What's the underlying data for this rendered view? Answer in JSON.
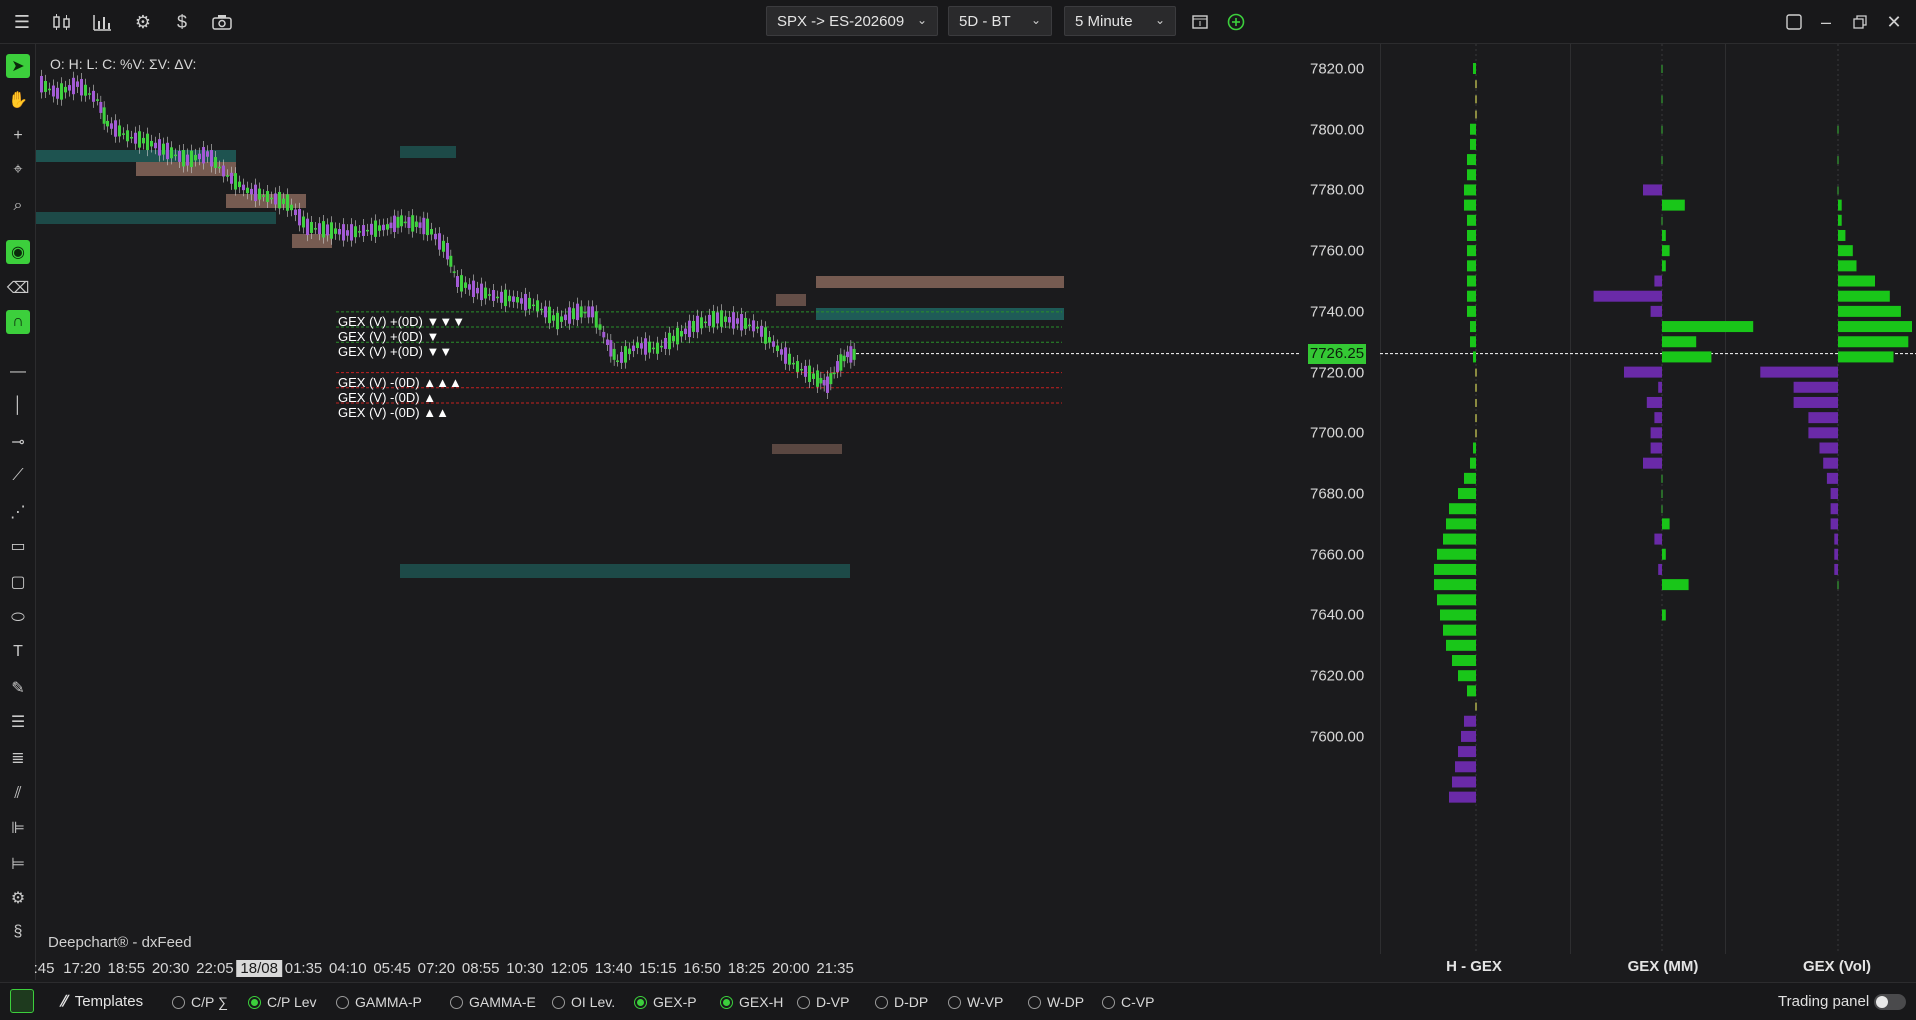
{
  "toolbar": {
    "symbol": "SPX -> ES-202609",
    "range": "5D - BT",
    "interval": "5 Minute"
  },
  "chart": {
    "ohlc_line": "O: H: L: C: %V: ΣV: ΔV:",
    "brand": "Deepchart® - dxFeed",
    "current_price": "7726.25",
    "gex_labels": [
      {
        "text": "GEX (V) +(0D)  ▼▼▼",
        "price": 7740,
        "color": "#2a8f2a"
      },
      {
        "text": "GEX (V) +(0D)  ▼",
        "price": 7735,
        "color": "#2a8f2a"
      },
      {
        "text": "GEX (V) +(0D)  ▼▼",
        "price": 7730,
        "color": "#2a8f2a"
      },
      {
        "text": "GEX (V) -(0D)  ▲▲▲",
        "price": 7720,
        "color": "#c42020"
      },
      {
        "text": "GEX (V) -(0D)  ▲",
        "price": 7715,
        "color": "#c42020"
      },
      {
        "text": "GEX (V) -(0D)  ▲▲",
        "price": 7710,
        "color": "#c42020"
      }
    ]
  },
  "time_axis": [
    ":45",
    "17:20",
    "18:55",
    "20:30",
    "22:05",
    "18/08",
    "01:35",
    "04:10",
    "05:45",
    "07:20",
    "08:55",
    "10:30",
    "12:05",
    "13:40",
    "15:15",
    "16:50",
    "18:25",
    "20:00",
    "21:35"
  ],
  "price_axis": [
    "7820.00",
    "7800.00",
    "7780.00",
    "7760.00",
    "7740.00",
    "7720.00",
    "7700.00",
    "7680.00",
    "7660.00",
    "7640.00",
    "7620.00",
    "7600.00"
  ],
  "profiles": {
    "titles": [
      "H - GEX",
      "GEX (MM)",
      "GEX (Vol)"
    ],
    "colors": {
      "positive": "#19c619",
      "negative": "#6a2aa8",
      "weak": "#8a8a40"
    },
    "hgex": [
      [
        7820,
        1
      ],
      [
        7815,
        0
      ],
      [
        7810,
        0
      ],
      [
        7805,
        0
      ],
      [
        7800,
        2
      ],
      [
        7795,
        2
      ],
      [
        7790,
        3
      ],
      [
        7785,
        3
      ],
      [
        7780,
        4
      ],
      [
        7775,
        4
      ],
      [
        7770,
        3
      ],
      [
        7765,
        3
      ],
      [
        7760,
        3
      ],
      [
        7755,
        3
      ],
      [
        7750,
        3
      ],
      [
        7745,
        3
      ],
      [
        7740,
        3
      ],
      [
        7735,
        2
      ],
      [
        7730,
        2
      ],
      [
        7725,
        1
      ],
      [
        7720,
        0
      ],
      [
        7715,
        0
      ],
      [
        7710,
        0
      ],
      [
        7705,
        0
      ],
      [
        7700,
        0
      ],
      [
        7695,
        1
      ],
      [
        7690,
        2
      ],
      [
        7685,
        4
      ],
      [
        7680,
        6
      ],
      [
        7675,
        9
      ],
      [
        7670,
        10
      ],
      [
        7665,
        11
      ],
      [
        7660,
        13
      ],
      [
        7655,
        14
      ],
      [
        7650,
        14
      ],
      [
        7645,
        13
      ],
      [
        7640,
        12
      ],
      [
        7635,
        11
      ],
      [
        7630,
        10
      ],
      [
        7625,
        8
      ],
      [
        7620,
        6
      ],
      [
        7615,
        3
      ],
      [
        7610,
        0
      ],
      [
        7605,
        -4
      ],
      [
        7600,
        -5
      ],
      [
        7595,
        -6
      ],
      [
        7590,
        -7
      ],
      [
        7585,
        -8
      ],
      [
        7580,
        -9
      ]
    ],
    "mm": [
      [
        7820,
        0
      ],
      [
        7810,
        0
      ],
      [
        7800,
        0
      ],
      [
        7790,
        0
      ],
      [
        7780,
        -5
      ],
      [
        7775,
        6
      ],
      [
        7770,
        0
      ],
      [
        7765,
        1
      ],
      [
        7760,
        2
      ],
      [
        7755,
        1
      ],
      [
        7750,
        -2
      ],
      [
        7745,
        -18
      ],
      [
        7740,
        -3
      ],
      [
        7735,
        24
      ],
      [
        7730,
        9
      ],
      [
        7725,
        13
      ],
      [
        7720,
        -10
      ],
      [
        7715,
        -1
      ],
      [
        7710,
        -4
      ],
      [
        7705,
        -2
      ],
      [
        7700,
        -3
      ],
      [
        7695,
        -3
      ],
      [
        7690,
        -5
      ],
      [
        7685,
        0
      ],
      [
        7680,
        0
      ],
      [
        7675,
        0
      ],
      [
        7670,
        2
      ],
      [
        7665,
        -2
      ],
      [
        7660,
        1
      ],
      [
        7655,
        -1
      ],
      [
        7650,
        7
      ],
      [
        7640,
        1
      ]
    ],
    "vol": [
      [
        7800,
        0
      ],
      [
        7790,
        0
      ],
      [
        7780,
        0
      ],
      [
        7775,
        1
      ],
      [
        7770,
        1
      ],
      [
        7765,
        2
      ],
      [
        7760,
        4
      ],
      [
        7755,
        5
      ],
      [
        7750,
        10
      ],
      [
        7745,
        14
      ],
      [
        7740,
        17
      ],
      [
        7735,
        20
      ],
      [
        7730,
        19
      ],
      [
        7725,
        15
      ],
      [
        7720,
        -21
      ],
      [
        7715,
        -12
      ],
      [
        7710,
        -12
      ],
      [
        7705,
        -8
      ],
      [
        7700,
        -8
      ],
      [
        7695,
        -5
      ],
      [
        7690,
        -4
      ],
      [
        7685,
        -3
      ],
      [
        7680,
        -2
      ],
      [
        7675,
        -2
      ],
      [
        7670,
        -2
      ],
      [
        7665,
        -1
      ],
      [
        7660,
        -1
      ],
      [
        7655,
        -1
      ],
      [
        7650,
        0
      ]
    ]
  },
  "bottom": {
    "templates_label": "Templates",
    "options": [
      {
        "label": "C/P ∑",
        "on": false
      },
      {
        "label": "C/P Lev",
        "on": true
      },
      {
        "label": "GAMMA-P",
        "on": false
      },
      {
        "label": "GAMMA-E",
        "on": false
      },
      {
        "label": "OI Lev.",
        "on": false
      },
      {
        "label": "GEX-P",
        "on": true
      },
      {
        "label": "GEX-H",
        "on": true
      },
      {
        "label": "D-VP",
        "on": false
      },
      {
        "label": "D-DP",
        "on": false
      },
      {
        "label": "W-VP",
        "on": false
      },
      {
        "label": "W-DP",
        "on": false
      },
      {
        "label": "C-VP",
        "on": false
      }
    ],
    "trading_panel_label": "Trading panel"
  }
}
